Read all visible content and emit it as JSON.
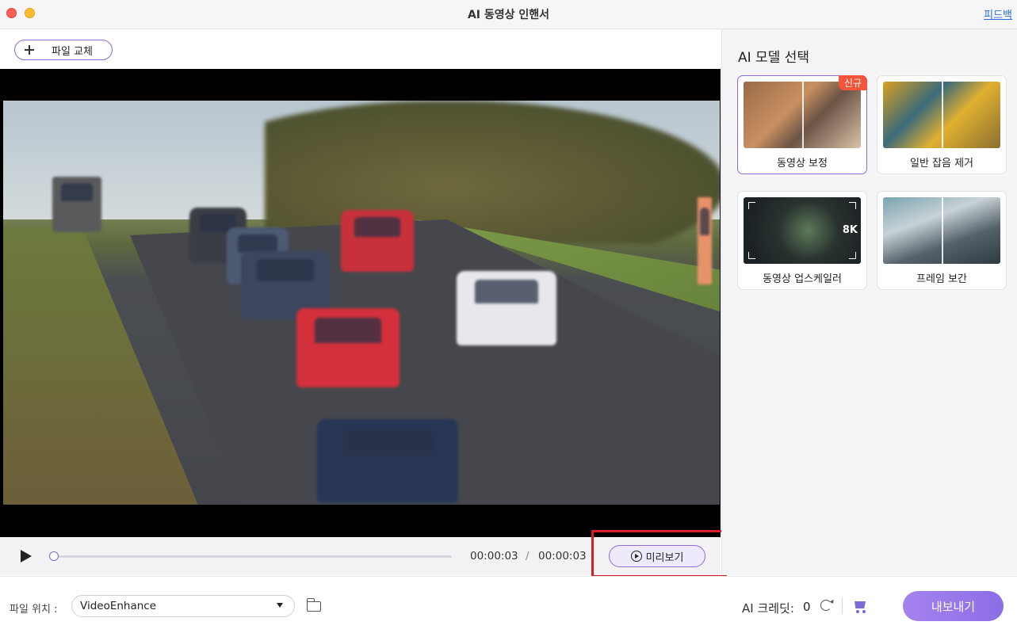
{
  "window": {
    "title": "AI 동영상 인핸서",
    "feedback_link": "피드백"
  },
  "toolbar": {
    "replace_file_label": "파일 교체"
  },
  "player": {
    "current_time": "00:00:03",
    "separator": "/",
    "total_time": "00:00:03",
    "progress": 0,
    "preview_label": "미리보기"
  },
  "models": {
    "title": "AI 모델 선택",
    "items": [
      {
        "label": "동영상 보정",
        "badge": "신규",
        "selected": true
      },
      {
        "label": "일반 잡음 제거",
        "selected": false
      },
      {
        "label": "동영상 업스케일러",
        "tag": "8K",
        "selected": false
      },
      {
        "label": "프레임 보간",
        "selected": false
      }
    ]
  },
  "bottom": {
    "location_label": "파일 위치 :",
    "location_value": "VideoEnhance",
    "credit_label": "AI 크레딧:",
    "credit_value": "0",
    "export_label": "내보내기"
  },
  "colors": {
    "accent": "#8f6bd8",
    "badge": "#f4553a",
    "highlight": "#d5202a",
    "link": "#2a6fdb"
  },
  "icons": [
    "plus-icon",
    "play-icon",
    "preview-play-icon",
    "folder-icon",
    "refresh-icon",
    "cart-icon",
    "chevron-down-icon"
  ]
}
